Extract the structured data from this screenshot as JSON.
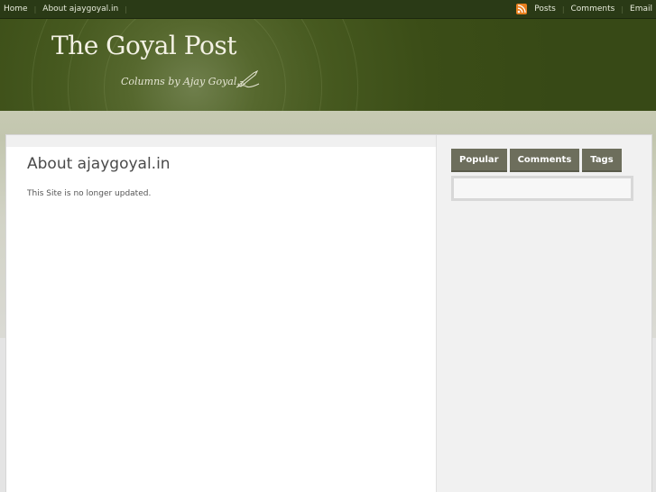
{
  "topnav": {
    "items": [
      "Home",
      "About ajaygoyal.in"
    ]
  },
  "toplinks": {
    "icon": "rss-icon",
    "items": [
      "Posts",
      "Comments",
      "Email"
    ]
  },
  "header": {
    "title": "The Goyal Post",
    "tagline": "Columns by Ajay Goyal...",
    "icon": "pen-icon"
  },
  "page": {
    "title": "About ajaygoyal.in",
    "text": "This Site is no longer updated."
  },
  "sidebar": {
    "tabs": [
      "Popular",
      "Comments",
      "Tags"
    ]
  },
  "colors": {
    "topbar": "#2a3a16",
    "header": "#3e5119",
    "tab": "#6d6e5c",
    "rss": "#e8801e"
  }
}
